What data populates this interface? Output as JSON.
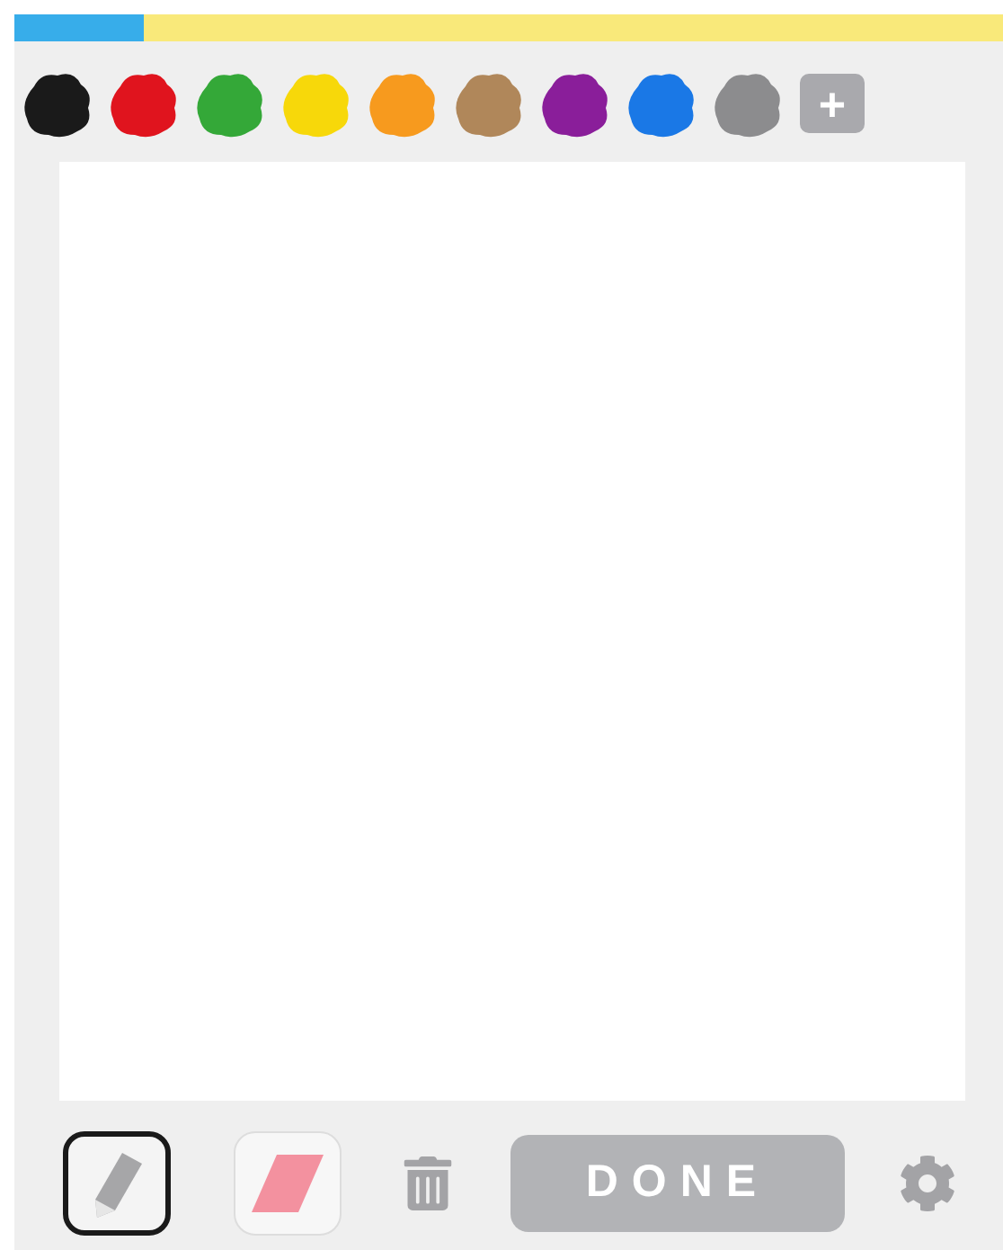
{
  "progress": {
    "level": 0.13
  },
  "palette": [
    {
      "color": "#1a1a1a"
    },
    {
      "color": "#e0141e"
    },
    {
      "color": "#34a838"
    },
    {
      "color": "#f7d80a"
    },
    {
      "color": "#f79a1e"
    },
    {
      "color": "#b0875a"
    },
    {
      "color": "#8a1e9a"
    },
    {
      "color": "#1a78e6"
    },
    {
      "color": "#8c8c8e"
    }
  ],
  "add_color": "+",
  "tools": [
    {
      "kind": "pencil",
      "selected": true
    },
    {
      "kind": "eraser",
      "selected": false
    }
  ],
  "done": {
    "label": "DONE",
    "disabled": true
  }
}
